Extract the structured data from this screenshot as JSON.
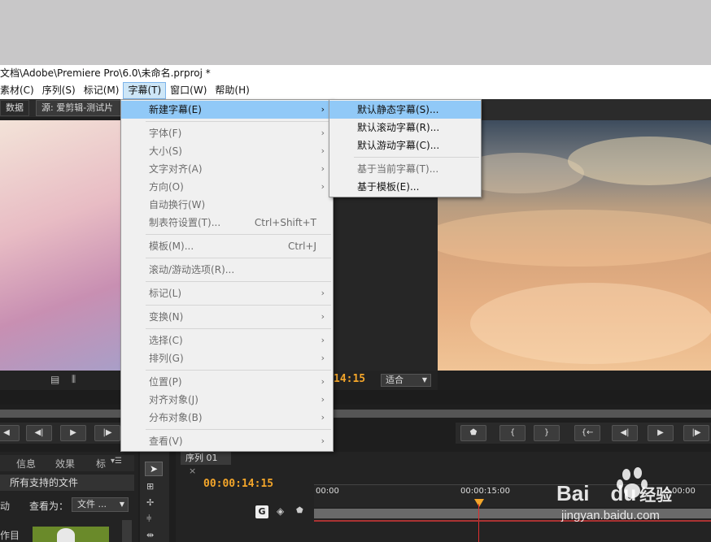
{
  "window": {
    "title": "文档\\Adobe\\Premiere Pro\\6.0\\未命名.prproj *"
  },
  "menubar": {
    "items": [
      {
        "label": "素材(C)"
      },
      {
        "label": "序列(S)"
      },
      {
        "label": "标记(M)"
      },
      {
        "label": "字幕(T)"
      },
      {
        "label": "窗口(W)"
      },
      {
        "label": "帮助(H)"
      }
    ]
  },
  "panels": {
    "source_tab_left": "数据",
    "source_tab": "源: 爱剪辑-测试片",
    "program_timecode": "14:15",
    "zoom_select": "适合",
    "project_tabs": [
      "信息",
      "效果",
      "标"
    ],
    "file_filter": "所有支持的文件",
    "view_as_label": "查看为：",
    "view_as_value": "文件 ...",
    "left_partial_1": "动",
    "left_partial_2": "作目",
    "sequence_tab": "序列 01",
    "seq_timecode": "00:00:14:15",
    "ruler_labels": [
      "00:00",
      "00:00:15:00",
      "00:00"
    ]
  },
  "title_menu": {
    "items": [
      {
        "label": "新建字幕(E)",
        "shortcut": "",
        "submenu": true,
        "enabled": true,
        "highlighted": true
      },
      {
        "sep": true
      },
      {
        "label": "字体(F)",
        "shortcut": "",
        "submenu": true,
        "enabled": false
      },
      {
        "label": "大小(S)",
        "shortcut": "",
        "submenu": true,
        "enabled": false
      },
      {
        "label": "文字对齐(A)",
        "shortcut": "",
        "submenu": true,
        "enabled": false
      },
      {
        "label": "方向(O)",
        "shortcut": "",
        "submenu": true,
        "enabled": false
      },
      {
        "label": "自动换行(W)",
        "shortcut": "",
        "submenu": false,
        "enabled": false
      },
      {
        "label": "制表符设置(T)...",
        "shortcut": "Ctrl+Shift+T",
        "submenu": false,
        "enabled": false
      },
      {
        "sep": true
      },
      {
        "label": "模板(M)...",
        "shortcut": "Ctrl+J",
        "submenu": false,
        "enabled": false
      },
      {
        "sep": true
      },
      {
        "label": "滚动/游动选项(R)...",
        "shortcut": "",
        "submenu": false,
        "enabled": false
      },
      {
        "sep": true
      },
      {
        "label": "标记(L)",
        "shortcut": "",
        "submenu": true,
        "enabled": false
      },
      {
        "sep": true
      },
      {
        "label": "变换(N)",
        "shortcut": "",
        "submenu": true,
        "enabled": false
      },
      {
        "sep": true
      },
      {
        "label": "选择(C)",
        "shortcut": "",
        "submenu": true,
        "enabled": false
      },
      {
        "label": "排列(G)",
        "shortcut": "",
        "submenu": true,
        "enabled": false
      },
      {
        "sep": true
      },
      {
        "label": "位置(P)",
        "shortcut": "",
        "submenu": true,
        "enabled": false
      },
      {
        "label": "对齐对象(J)",
        "shortcut": "",
        "submenu": true,
        "enabled": false
      },
      {
        "label": "分布对象(B)",
        "shortcut": "",
        "submenu": true,
        "enabled": false
      },
      {
        "sep": true
      },
      {
        "label": "查看(V)",
        "shortcut": "",
        "submenu": true,
        "enabled": false
      }
    ]
  },
  "new_title_submenu": {
    "items": [
      {
        "label": "默认静态字幕(S)...",
        "enabled": true,
        "highlighted": true
      },
      {
        "label": "默认滚动字幕(R)...",
        "enabled": true
      },
      {
        "label": "默认游动字幕(C)...",
        "enabled": true
      },
      {
        "sep": true
      },
      {
        "label": "基于当前字幕(T)...",
        "enabled": false
      },
      {
        "label": "基于模板(E)...",
        "enabled": true
      }
    ]
  },
  "watermark": {
    "brand": "Bai",
    "brand2": "du",
    "suffix": "经验",
    "url": "jingyan.baidu.com"
  },
  "colors": {
    "accent_timecode": "#f4a62a",
    "menu_highlight": "#91c9f7",
    "playhead": "#e03030"
  }
}
